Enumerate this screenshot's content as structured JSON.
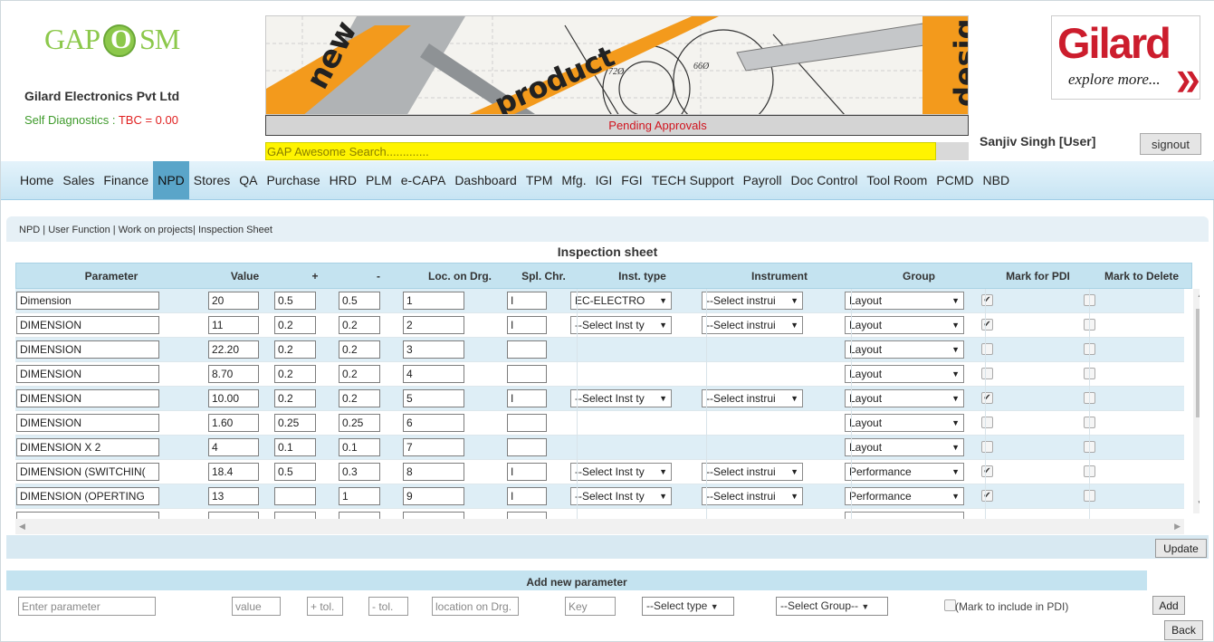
{
  "header": {
    "logo_gap": "GAP",
    "logo_o": "O",
    "logo_sm": "SM",
    "company": "Gilard Electronics Pvt Ltd",
    "self_diag_label": "Self Diagnostics :",
    "self_diag_value": "TBC = 0.00",
    "banner_words": [
      "new",
      "product",
      "design"
    ],
    "banner_dim1": "72Ø",
    "banner_dim2": "66Ø",
    "pending": "Pending Approvals",
    "search_placeholder": "GAP Awesome Search.............",
    "brand_name": "Gilard",
    "brand_tagline": "explore more...",
    "user": "Sanjiv Singh [User]",
    "signout": "signout"
  },
  "nav": [
    "Home",
    "Sales",
    "Finance",
    "NPD",
    "Stores",
    "QA",
    "Purchase",
    "HRD",
    "PLM",
    "e-CAPA",
    "Dashboard",
    "TPM",
    "Mfg.",
    "IGI",
    "FGI",
    "TECH Support",
    "Payroll",
    "Doc Control",
    "Tool Room",
    "PCMD",
    "NBD"
  ],
  "nav_active": "NPD",
  "breadcrumb": {
    "a": "NPD",
    "b": "User Function",
    "c": "Work on projects",
    "d": "Inspection Sheet"
  },
  "sheet_title": "Inspection sheet",
  "columns": [
    "Parameter",
    "Value",
    "+",
    "-",
    "Loc. on Drg.",
    "Spl. Chr.",
    "Inst. type",
    "Instrument",
    "Group",
    "Mark for PDI",
    "Mark to Delete"
  ],
  "rows": [
    {
      "param": "Dimension",
      "value": "20",
      "plus": "0.5",
      "minus": "0.5",
      "loc": "1",
      "spl": "I",
      "inst_type": "EC-ELECTRO",
      "instrument": "--Select instrui",
      "group": "Layout",
      "pdi": true,
      "del": false
    },
    {
      "param": "DIMENSION",
      "value": "11",
      "plus": "0.2",
      "minus": "0.2",
      "loc": "2",
      "spl": "I",
      "inst_type": "--Select Inst ty",
      "instrument": "--Select instrui",
      "group": "Layout",
      "pdi": true,
      "del": false
    },
    {
      "param": "DIMENSION",
      "value": "22.20",
      "plus": "0.2",
      "minus": "0.2",
      "loc": "3",
      "spl": "",
      "inst_type": "",
      "instrument": "",
      "group": "Layout",
      "pdi": false,
      "del": false
    },
    {
      "param": "DIMENSION",
      "value": "8.70",
      "plus": "0.2",
      "minus": "0.2",
      "loc": "4",
      "spl": "",
      "inst_type": "",
      "instrument": "",
      "group": "Layout",
      "pdi": false,
      "del": false
    },
    {
      "param": "DIMENSION",
      "value": "10.00",
      "plus": "0.2",
      "minus": "0.2",
      "loc": "5",
      "spl": "I",
      "inst_type": "--Select Inst ty",
      "instrument": "--Select instrui",
      "group": "Layout",
      "pdi": true,
      "del": false
    },
    {
      "param": "DIMENSION",
      "value": "1.60",
      "plus": "0.25",
      "minus": "0.25",
      "loc": "6",
      "spl": "",
      "inst_type": "",
      "instrument": "",
      "group": "Layout",
      "pdi": false,
      "del": false
    },
    {
      "param": "DIMENSION X 2",
      "value": "4",
      "plus": "0.1",
      "minus": "0.1",
      "loc": "7",
      "spl": "",
      "inst_type": "",
      "instrument": "",
      "group": "Layout",
      "pdi": false,
      "del": false
    },
    {
      "param": "DIMENSION (SWITCHIN(",
      "value": "18.4",
      "plus": "0.5",
      "minus": "0.3",
      "loc": "8",
      "spl": "I",
      "inst_type": "--Select Inst ty",
      "instrument": "--Select instrui",
      "group": "Performance",
      "pdi": true,
      "del": false
    },
    {
      "param": "DIMENSION (OPERTING",
      "value": "13",
      "plus": "",
      "minus": "1",
      "loc": "9",
      "spl": "I",
      "inst_type": "--Select Inst ty",
      "instrument": "--Select instrui",
      "group": "Performance",
      "pdi": true,
      "del": false
    }
  ],
  "update": "Update",
  "add_section": {
    "title": "Add new parameter",
    "param_placeholder": "Enter parameter",
    "value_placeholder": "value",
    "plus_placeholder": "+ tol.",
    "minus_placeholder": "- tol.",
    "loc_placeholder": "location on Drg.",
    "key_placeholder": "Key",
    "type_select": "--Select type",
    "group_select": "--Select Group--",
    "pdi_label": "(Mark to include in PDI)",
    "add": "Add"
  },
  "back": "Back"
}
